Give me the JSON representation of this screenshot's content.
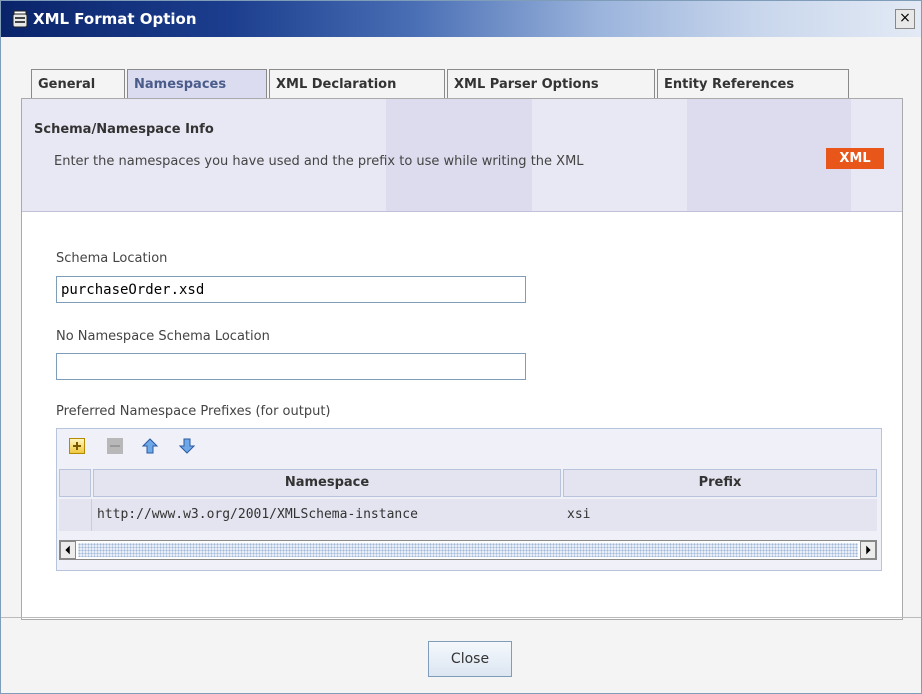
{
  "window": {
    "title": "XML Format Option",
    "close_symbol": "×",
    "icon": "jar-icon"
  },
  "tabs": [
    {
      "label": "General",
      "active": false
    },
    {
      "label": "Namespaces",
      "active": true
    },
    {
      "label": "XML Declaration",
      "active": false
    },
    {
      "label": "XML Parser Options",
      "active": false
    },
    {
      "label": "Entity References",
      "active": false
    }
  ],
  "info": {
    "title": "Schema/Namespace Info",
    "description": "Enter the namespaces you have used and the prefix to use while writing the XML",
    "badge": "XML"
  },
  "form": {
    "schema_location_label": "Schema Location",
    "schema_location_value": "purchaseOrder.xsd",
    "no_namespace_label": "No Namespace Schema Location",
    "no_namespace_value": "",
    "prefixes_label": "Preferred Namespace Prefixes (for output)"
  },
  "grid": {
    "columns": [
      "Namespace",
      "Prefix"
    ],
    "rows": [
      {
        "namespace": "http://www.w3.org/2001/XMLSchema-instance",
        "prefix": "xsi"
      }
    ],
    "toolbar": [
      "add-icon",
      "remove-icon",
      "move-up-icon",
      "move-down-icon"
    ]
  },
  "footer": {
    "close_label": "Close"
  },
  "colors": {
    "title_gradient_start": "#0a246a",
    "active_tab": "#dcdcf0",
    "badge": "#e8561a"
  }
}
